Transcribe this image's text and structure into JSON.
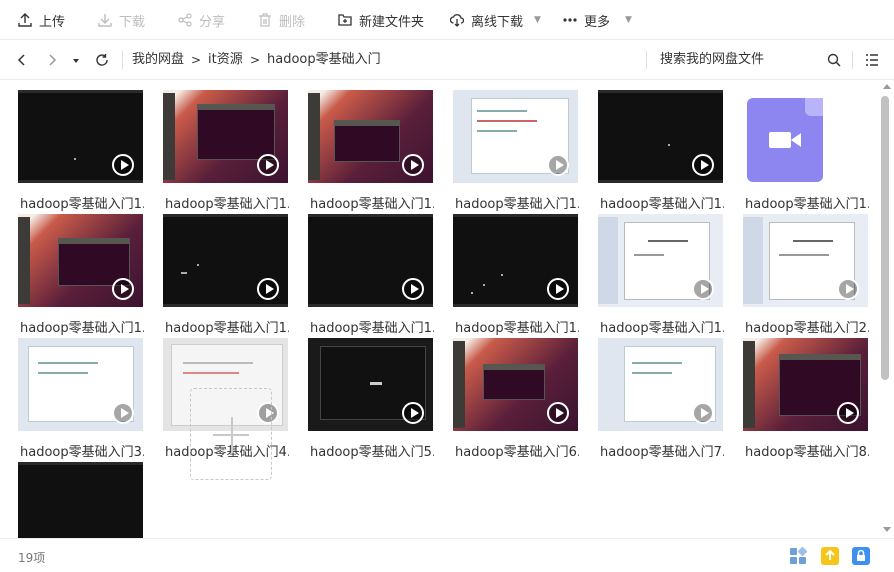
{
  "toolbar": {
    "upload": "上传",
    "download": "下载",
    "share": "分享",
    "delete": "删除",
    "new_folder": "新建文件夹",
    "offline_download": "离线下载",
    "more": "更多"
  },
  "nav": {
    "breadcrumbs": [
      "我的网盘",
      "it资源",
      "hadoop零基础入门"
    ],
    "separator": ">",
    "search_placeholder": "搜索我的网盘文件"
  },
  "files": [
    {
      "name": "hadoop零基础入门1...",
      "thumb": "black"
    },
    {
      "name": "hadoop零基础入门1...",
      "thumb": "ubuntu-terminal"
    },
    {
      "name": "hadoop零基础入门1...",
      "thumb": "ubuntu-terminal"
    },
    {
      "name": "hadoop零基础入门1...",
      "thumb": "web-page"
    },
    {
      "name": "hadoop零基础入门1...",
      "thumb": "black"
    },
    {
      "name": "hadoop零基础入门1...",
      "thumb": "video-icon"
    },
    {
      "name": "hadoop零基础入门1...",
      "thumb": "ubuntu-terminal"
    },
    {
      "name": "hadoop零基础入门1...",
      "thumb": "black"
    },
    {
      "name": "hadoop零基础入门1...",
      "thumb": "black"
    },
    {
      "name": "hadoop零基础入门1...",
      "thumb": "black"
    },
    {
      "name": "hadoop零基础入门1...",
      "thumb": "document"
    },
    {
      "name": "hadoop零基础入门2...",
      "thumb": "document"
    },
    {
      "name": "hadoop零基础入门3...",
      "thumb": "web-page"
    },
    {
      "name": "hadoop零基础入门4...",
      "thumb": "gray-text"
    },
    {
      "name": "hadoop零基础入门5...",
      "thumb": "black"
    },
    {
      "name": "hadoop零基础入门6...",
      "thumb": "ubuntu-terminal"
    },
    {
      "name": "hadoop零基础入门7...",
      "thumb": "web-page"
    },
    {
      "name": "hadoop零基础入门8...",
      "thumb": "ubuntu-terminal"
    },
    {
      "name": "",
      "thumb": "black"
    }
  ],
  "status": {
    "count": "19项"
  },
  "colors": {
    "video_tile": "#8d86f0",
    "status_icon_grid": "#6d9fd8",
    "status_icon_upload": "#f5c518",
    "status_icon_lock": "#3d8ff0"
  }
}
